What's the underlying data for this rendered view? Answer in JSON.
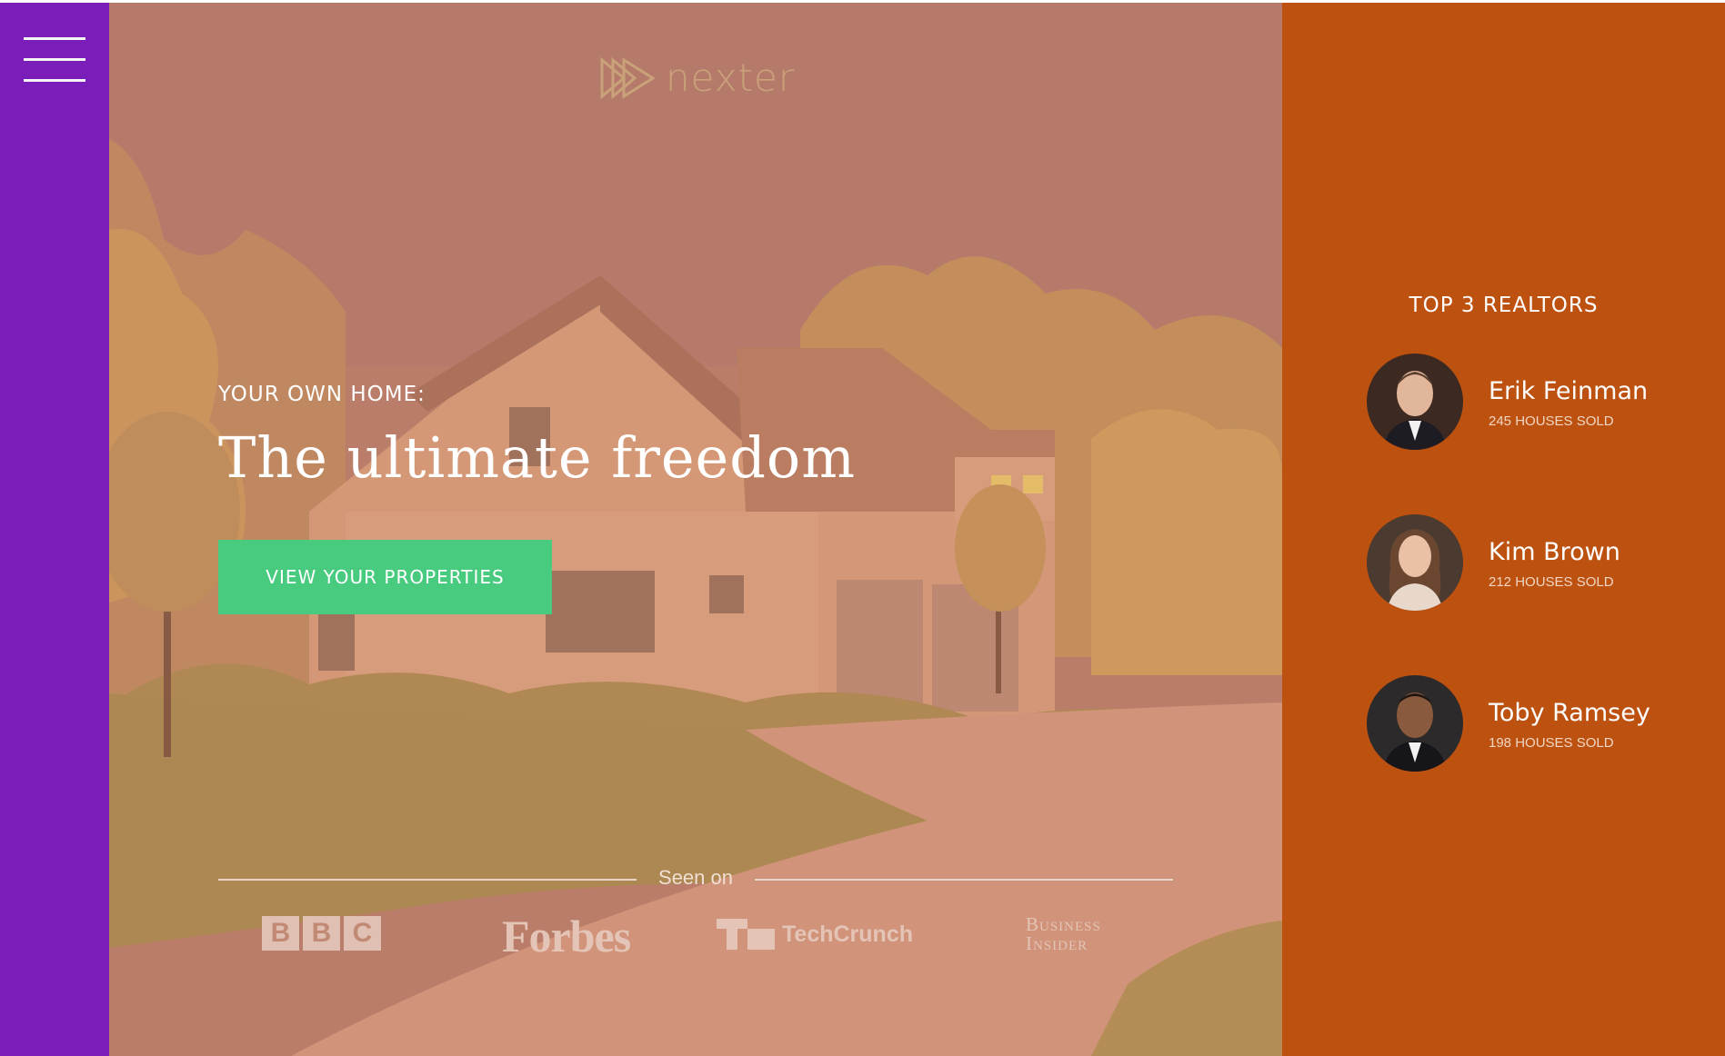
{
  "menu": {
    "icon": "hamburger-menu-icon"
  },
  "logo": {
    "text": "nexter",
    "icon": "triple-chevron-logo-icon"
  },
  "hero": {
    "kicker": "YOUR OWN HOME:",
    "headline": "The ultimate freedom",
    "cta_label": "VIEW YOUR PROPERTIES"
  },
  "seen_on": {
    "label": "Seen on",
    "brands": {
      "bbc": [
        "B",
        "B",
        "C"
      ],
      "forbes": "Forbes",
      "techcrunch": "TechCrunch",
      "business_insider": [
        "Business",
        "Insider"
      ]
    }
  },
  "realtors": {
    "title": "TOP 3 REALTORS",
    "items": [
      {
        "name": "Erik Feinman",
        "sold": "245 HOUSES SOLD"
      },
      {
        "name": "Kim Brown",
        "sold": "212 HOUSES SOLD"
      },
      {
        "name": "Toby Ramsey",
        "sold": "198 HOUSES SOLD"
      }
    ]
  },
  "colors": {
    "sidebar": "#7b1db8",
    "realtors_panel": "#bd510f",
    "cta": "#49cb7f",
    "hero_overlay": "#c98a6a"
  }
}
